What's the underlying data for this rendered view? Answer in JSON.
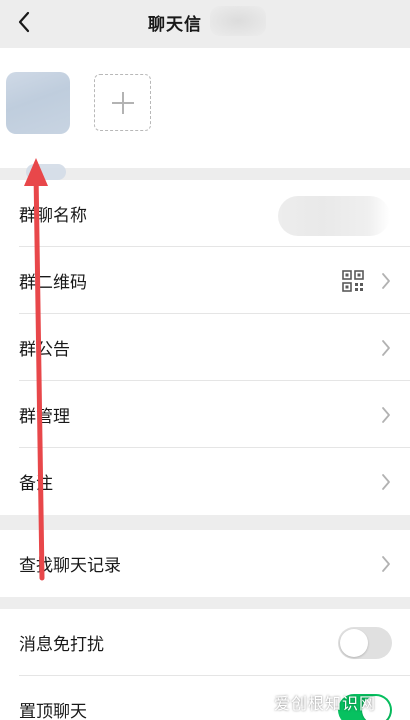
{
  "nav": {
    "title": "聊天信",
    "back_icon": "chevron-left-icon"
  },
  "members": {
    "add_icon": "plus-icon"
  },
  "settings": {
    "group_name_label": "群聊名称",
    "qr_code_label": "群二维码",
    "announcement_label": "群公告",
    "manage_label": "群管理",
    "remark_label": "备注",
    "search_history_label": "查找聊天记录",
    "mute_label": "消息免打扰",
    "pin_label": "置顶聊天"
  },
  "toggles": {
    "mute_on": false,
    "pin_on": true
  },
  "watermark": "爱创根知识网",
  "colors": {
    "accent_green": "#07c160",
    "annotation_arrow": "#e8474a",
    "background": "#ededed"
  }
}
